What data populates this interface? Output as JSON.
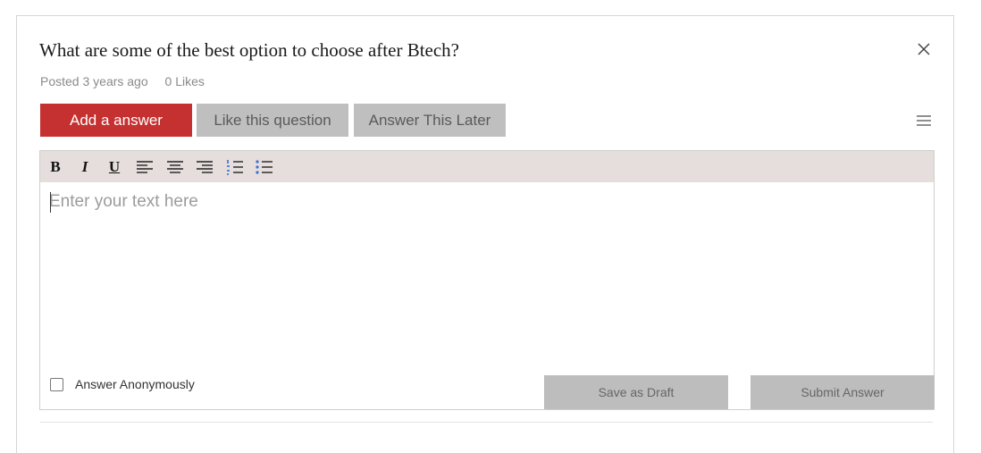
{
  "question": {
    "title": "What are some of the best option to choose after Btech?",
    "posted": "Posted 3 years ago",
    "likes": "0 Likes"
  },
  "actions": {
    "answer_label": "Add a answer",
    "like_label": "Like this question",
    "later_label": "Answer This Later"
  },
  "editor": {
    "toolbar": [
      "bold-icon",
      "italic-icon",
      "underline-icon",
      "align-left-icon",
      "align-center-icon",
      "align-right-icon",
      "ordered-list-icon",
      "unordered-list-icon"
    ],
    "placeholder": "Enter your text here",
    "anonymous_label": "Answer Anonymously",
    "draft_label": "Save as Draft",
    "submit_label": "Submit Answer"
  },
  "colors": {
    "primary": "#c53030",
    "secondary_button": "#bfbfbf",
    "toolbar_bg": "#e6dddd"
  }
}
